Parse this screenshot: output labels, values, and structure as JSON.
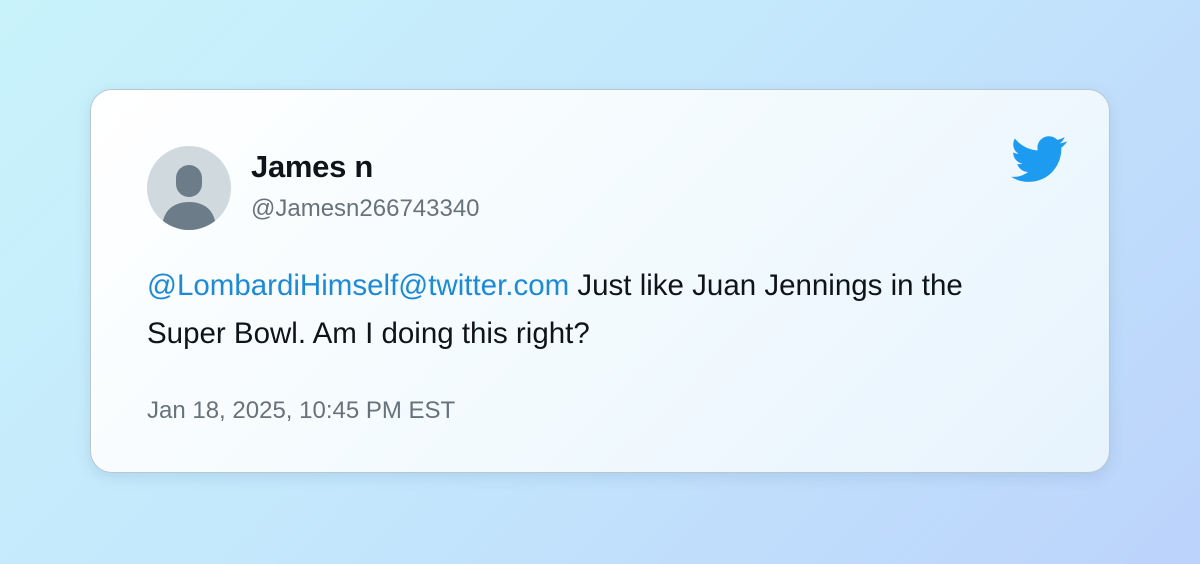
{
  "tweet": {
    "author_name": "James n",
    "author_handle": "@Jamesn266743340",
    "mention": "@LombardiHimself@twitter.com",
    "text": " Just like Juan Jennings in the Super Bowl. Am I doing this right?",
    "timestamp": "Jan 18, 2025, 10:45 PM EST"
  },
  "icons": {
    "avatar": "default-person-avatar",
    "brand": "twitter-bird-icon"
  },
  "colors": {
    "mention": "#1d8ad8",
    "brand": "#1d9bf0",
    "avatar_bg": "#cfd9de",
    "avatar_figure": "#6d7c89"
  }
}
